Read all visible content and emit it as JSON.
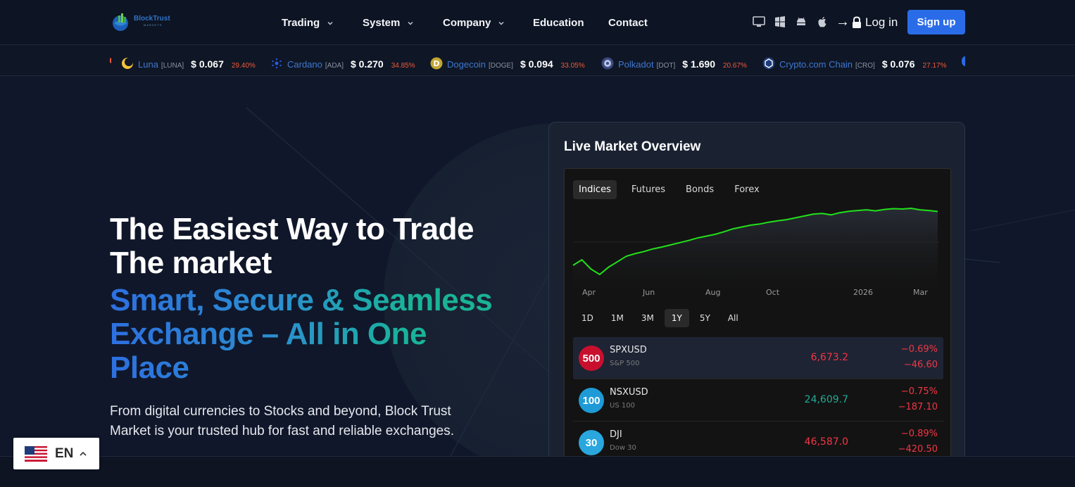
{
  "brand": {
    "name": "BlockTrust",
    "tagline": "MARKETS"
  },
  "nav": {
    "items": [
      {
        "label": "Trading",
        "dropdown": true
      },
      {
        "label": "System",
        "dropdown": true
      },
      {
        "label": "Company",
        "dropdown": true
      },
      {
        "label": "Education",
        "dropdown": false
      },
      {
        "label": "Contact",
        "dropdown": false
      }
    ],
    "platforms": [
      "desktop-icon",
      "windows-icon",
      "android-icon",
      "apple-icon"
    ],
    "login_label": "Log in",
    "signup_label": "Sign up",
    "accent": "#2a6ce8"
  },
  "ticker": [
    {
      "name": "Luna",
      "symbol": "[LUNA]",
      "price": "$ 0.067",
      "change": "29.40%",
      "icon": "luna-coin-icon",
      "color": "#f3c33c"
    },
    {
      "name": "Cardano",
      "symbol": "[ADA]",
      "price": "$ 0.270",
      "change": "34.85%",
      "icon": "cardano-coin-icon",
      "color": "#2a5ada"
    },
    {
      "name": "Dogecoin",
      "symbol": "[DOGE]",
      "price": "$ 0.094",
      "change": "33.05%",
      "icon": "dogecoin-coin-icon",
      "color": "#c2a633"
    },
    {
      "name": "Polkadot",
      "symbol": "[DOT]",
      "price": "$ 1.690",
      "change": "20.67%",
      "icon": "polkadot-coin-icon",
      "color": "#7d8ab8"
    },
    {
      "name": "Crypto.com Chain",
      "symbol": "[CRO]",
      "price": "$ 0.076",
      "change": "27.17%",
      "icon": "cro-coin-icon",
      "color": "#1d3c7a"
    }
  ],
  "hero": {
    "title_line1": "The Easiest Way to Trade",
    "title_line2": "The market",
    "subtitle_line1": "Smart, Secure & Seamless",
    "subtitle_line2": "Exchange – All in One",
    "subtitle_line3": "Place",
    "description": "From digital currencies to Stocks and beyond, Block Trust Market is your trusted hub for fast and reliable exchanges."
  },
  "widget": {
    "title": "Live Market Overview",
    "tabs": [
      "Indices",
      "Futures",
      "Bonds",
      "Forex"
    ],
    "active_tab": "Indices",
    "ranges": [
      "1D",
      "1M",
      "3M",
      "1Y",
      "5Y",
      "All"
    ],
    "active_range": "1Y",
    "line_color": "#22e01a",
    "rows": [
      {
        "badge": "500",
        "badge_color": "#c8102e",
        "symbol": "SPXUSD",
        "name": "S&P 500",
        "value": "6,673.2",
        "value_color": "#f23645",
        "pct": "−0.69%",
        "abs": "−46.60"
      },
      {
        "badge": "100",
        "badge_color": "#1e9bd7",
        "symbol": "NSXUSD",
        "name": "US 100",
        "value": "24,609.7",
        "value_color": "#22ab94",
        "pct": "−0.75%",
        "abs": "−187.10"
      },
      {
        "badge": "30",
        "badge_color": "#29a7de",
        "symbol": "DJI",
        "name": "Dow 30",
        "value": "46,587.0",
        "value_color": "#f23645",
        "pct": "−0.89%",
        "abs": "−420.50"
      }
    ]
  },
  "chart_data": {
    "type": "area",
    "title": "",
    "xlabel": "",
    "ylabel": "",
    "x_ticks": [
      "Apr",
      "Jun",
      "Aug",
      "Oct",
      "2026",
      "Mar"
    ],
    "grid": false,
    "legend": "none",
    "series": [
      {
        "values": [
          5200,
          5350,
          5100,
          4950,
          5150,
          5300,
          5450,
          5520,
          5580,
          5650,
          5700,
          5760,
          5820,
          5880,
          5950,
          6000,
          6050,
          6120,
          6200,
          6250,
          6300,
          6330,
          6380,
          6420,
          6450,
          6500,
          6550,
          6600,
          6620,
          6580,
          6640,
          6680,
          6700,
          6720,
          6690,
          6730,
          6750,
          6740,
          6760,
          6720,
          6700,
          6673
        ]
      }
    ]
  },
  "language": {
    "code": "EN",
    "flag": "us-flag-icon"
  }
}
